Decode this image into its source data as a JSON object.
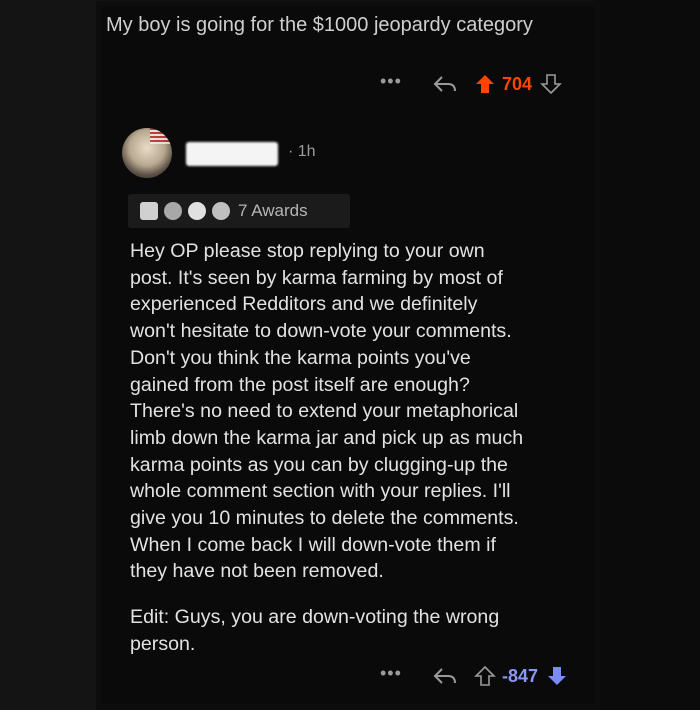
{
  "post": {
    "title": "My boy is going for the $1000 jeopardy category",
    "score": "704"
  },
  "comment": {
    "time": "· 1h",
    "awards_label": "7 Awards",
    "body": [
      "Hey OP please stop replying to your own",
      "post. It's seen by karma farming by most of",
      "experienced Redditors and we definitely",
      "won't hesitate to down-vote your comments.",
      "Don't you think the karma points you've",
      "gained from the post itself are enough?",
      "There's no need to extend your metaphorical",
      "limb down the karma jar and pick up as much",
      "karma points as you can by clugging-up the",
      "whole comment section with your replies. I'll",
      "give you 10 minutes to delete the comments.",
      "When I come back I will down-vote them if",
      "they have not been removed."
    ],
    "edit": [
      "Edit: Guys, you are down-voting the wrong",
      "person."
    ],
    "score": "-847"
  },
  "actions": {
    "more_label": "•••"
  },
  "colors": {
    "upvote_active": "#ff4500",
    "downvote_active": "#7a8cf5"
  },
  "icons": [
    "more-dots-icon",
    "reply-icon",
    "upvote-arrow-icon",
    "downvote-arrow-icon",
    "award-icon",
    "avatar"
  ]
}
